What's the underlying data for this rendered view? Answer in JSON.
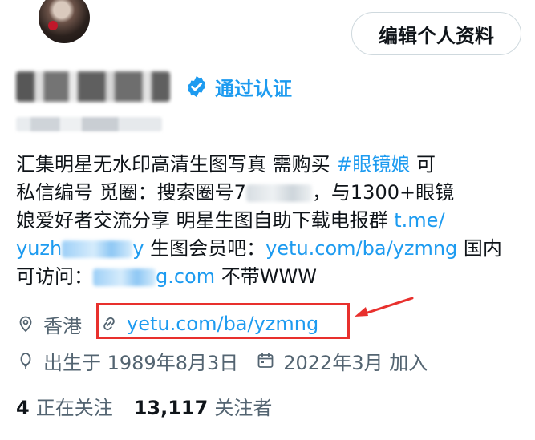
{
  "header": {
    "edit_profile_label": "编辑个人资料"
  },
  "profile": {
    "verified_label": "通过认证"
  },
  "bio": {
    "l1_a": "汇集明星无水印高清生图写真 需购买 ",
    "l1_tag": "#眼镜娘",
    "l1_b": " 可",
    "l2_a": "私信编号 觅圈：搜索圈号7",
    "l2_b": "，与1300+眼镜",
    "l3_a": "娘爱好者交流分享 明星生图自助下载电报群 ",
    "l3_link": "t.me/",
    "l4_link_a": "yuzh",
    "l4_link_b": "y",
    "l4_text": " 生图会员吧：",
    "l4_link2": "yetu.com/ba/yzmng",
    "l4_tail": " 国内",
    "l5_a": "可访问：",
    "l5_link": "g.com",
    "l5_b": " 不带WWW"
  },
  "meta": {
    "location": "香港",
    "website": "yetu.com/ba/yzmng",
    "birth": "出生于 1989年8月3日",
    "joined": "2022年3月 加入"
  },
  "stats": {
    "following_count": "4",
    "following_label": "正在关注",
    "followers_count": "13,117",
    "followers_label": "关注者"
  },
  "colors": {
    "link": "#1d9bf0",
    "annotation": "#e8302d",
    "secondary": "#536471"
  }
}
